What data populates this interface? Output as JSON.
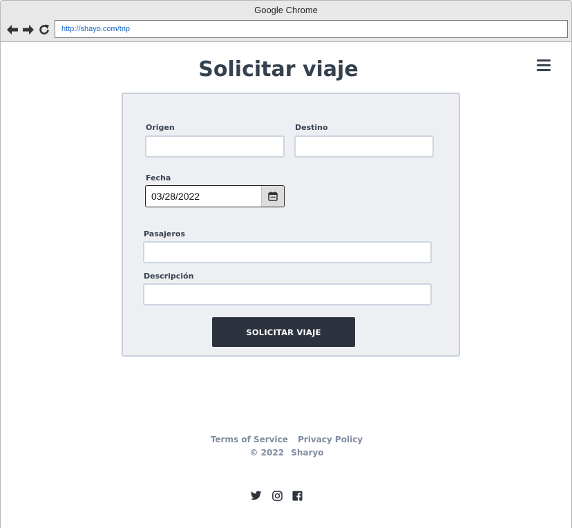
{
  "browser": {
    "window_title": "Google Chrome",
    "url": "http://shayo.com/trip",
    "icons": [
      "back-arrow-icon",
      "forward-arrow-icon",
      "reload-icon"
    ]
  },
  "page": {
    "title": "Solicitar viaje",
    "menu_icon": "hamburger-menu-icon"
  },
  "form": {
    "origin": {
      "label": "Origen",
      "value": ""
    },
    "destination": {
      "label": "Destino",
      "value": ""
    },
    "date": {
      "label": "Fecha",
      "value": "03/28/2022",
      "icon": "calendar-icon"
    },
    "passengers": {
      "label": "Pasajeros",
      "value": ""
    },
    "description": {
      "label": "Descripción",
      "value": ""
    },
    "submit_label": "SOLICITAR VIAJE"
  },
  "footer": {
    "terms": "Terms of Service",
    "privacy": "Privacy Policy",
    "copyright": "© 2022",
    "brand": "Sharyo",
    "social": [
      "twitter-icon",
      "instagram-icon",
      "facebook-icon"
    ]
  },
  "colors": {
    "title": "#35414f",
    "card_bg": "#edeff2",
    "button_bg": "#2d333e",
    "footer_text": "#7f8c9e",
    "url_text": "#1a6ac9"
  }
}
